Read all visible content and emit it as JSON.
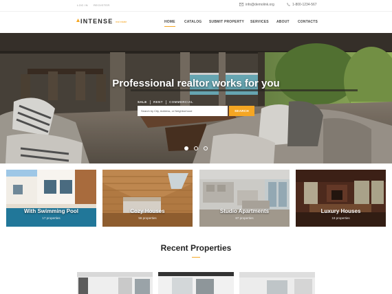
{
  "topbar": {
    "login": "LOG IN",
    "register": "REGISTER",
    "email": "info@demolink.org",
    "phone": "1-800-1234-567"
  },
  "logo": {
    "name": "INTENSE",
    "tagline": "real estate"
  },
  "nav": {
    "items": [
      "HOME",
      "CATALOG",
      "SUBMIT PROPERTY",
      "SERVICES",
      "ABOUT",
      "CONTACTS"
    ],
    "active": "HOME"
  },
  "hero": {
    "title": "Professional realtor works for you",
    "tabs": [
      "SALE",
      "RENT",
      "COMMERCIAL"
    ],
    "active_tab": "SALE",
    "search_placeholder": "Search by City, Address, or Neighborhood",
    "search_button": "SEARCH",
    "slides": 3,
    "active_slide": 1
  },
  "categories": [
    {
      "title": "With Swimming Pool",
      "count": "17 properties"
    },
    {
      "title": "Cozy Houses",
      "count": "56 properties"
    },
    {
      "title": "Studio Apartments",
      "count": "87 properties"
    },
    {
      "title": "Luxury Houses",
      "count": "19 properties"
    }
  ],
  "recent": {
    "title": "Recent Properties"
  },
  "colors": {
    "accent": "#f5a623",
    "text_dark": "#222222",
    "muted": "#999999"
  }
}
